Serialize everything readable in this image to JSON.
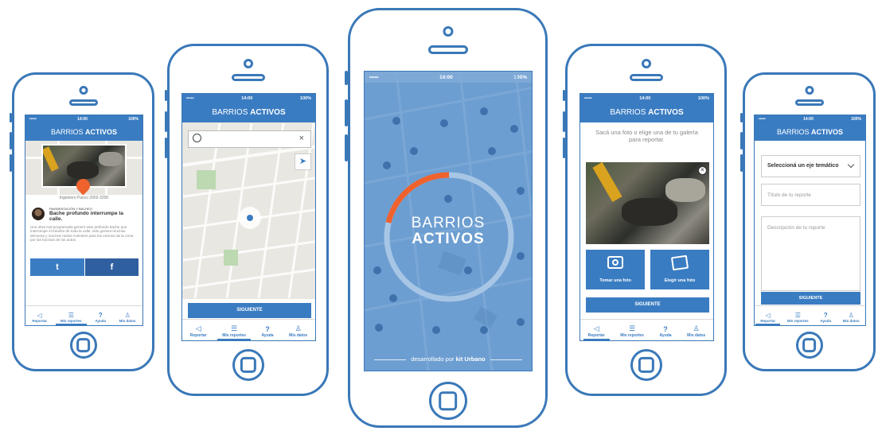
{
  "app": {
    "title_regular": "BARRIOS ",
    "title_bold": "ACTIVOS",
    "splash_line1": "BARRIOS",
    "splash_line2": "ACTIVOS",
    "footer_prefix": "desarrollado por ",
    "footer_brand": "kit Urbano"
  },
  "status": {
    "carrier": "•••••",
    "time": "14:00",
    "battery": "100%"
  },
  "tabs": [
    {
      "label": "Reportar",
      "icon": "megaphone-icon"
    },
    {
      "label": "Mis reportes",
      "icon": "list-icon"
    },
    {
      "label": "Ayuda",
      "icon": "help-icon"
    },
    {
      "label": "Mis datos",
      "icon": "user-icon"
    }
  ],
  "screen1": {
    "address": "Ingeniero Pasco 2002-2200",
    "category": "PAVIMENTACIÓN Y BACHEO",
    "report_title": "Bache profundo interrumpe la calle.",
    "description": "Una obra mal programada generó este profundo bache que interrumpe el tránsito de toda la calle, esto genera muchas demoras y muchos ruidos molestos para los vecinos de la zona por las bocinas de los autos.",
    "twitter_glyph": "t",
    "facebook_glyph": "f"
  },
  "screen2": {
    "search_placeholder": "",
    "clear_glyph": "×",
    "next_button": "SIGUIENTE"
  },
  "screen4": {
    "instruction": "Sacá una foto o elige una de tu galería para reportar.",
    "take_photo": "Tomar una foto",
    "choose_photo": "Elegir una foto",
    "next_button": "SIGUIENTE"
  },
  "screen5": {
    "select_label": "Seleccioná un eje temático",
    "title_placeholder": "Título de tu reporte",
    "description_placeholder": "Descripción de tu reporte",
    "next_button": "SIGUIENTE"
  },
  "colors": {
    "brand_blue": "#3a7cc2",
    "accent_orange": "#f0622d",
    "phone_outline": "#3a78b8"
  }
}
